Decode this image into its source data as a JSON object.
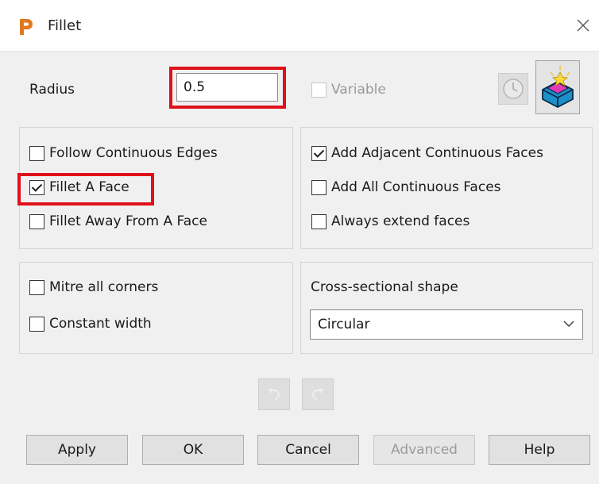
{
  "window": {
    "title": "Fillet",
    "app_icon": "P"
  },
  "radius": {
    "label": "Radius",
    "value": "0.5"
  },
  "variable": {
    "label": "Variable",
    "checked": false,
    "enabled": false
  },
  "options_left": [
    {
      "label": "Follow Continuous Edges",
      "checked": false
    },
    {
      "label": "Fillet A Face",
      "checked": true
    },
    {
      "label": "Fillet Away From A Face",
      "checked": false
    }
  ],
  "options_right": [
    {
      "label": "Add Adjacent Continuous Faces",
      "checked": true
    },
    {
      "label": "Add All Continuous Faces",
      "checked": false
    },
    {
      "label": "Always extend faces",
      "checked": false
    }
  ],
  "corners": [
    {
      "label": "Mitre all corners",
      "checked": false
    },
    {
      "label": "Constant width",
      "checked": false
    }
  ],
  "cross_section": {
    "label": "Cross-sectional shape",
    "value": "Circular"
  },
  "buttons": {
    "apply": "Apply",
    "ok": "OK",
    "cancel": "Cancel",
    "advanced": "Advanced",
    "help": "Help"
  },
  "icons": {
    "app": "powershape-icon",
    "close": "close-icon",
    "history": "clock-icon",
    "preview": "solid-fillet-icon",
    "undo": "undo-icon",
    "redo": "redo-icon",
    "dropdown": "chevron-down-icon"
  },
  "colors": {
    "highlight": "#e0101a",
    "app_icon": "#e07a1f"
  }
}
